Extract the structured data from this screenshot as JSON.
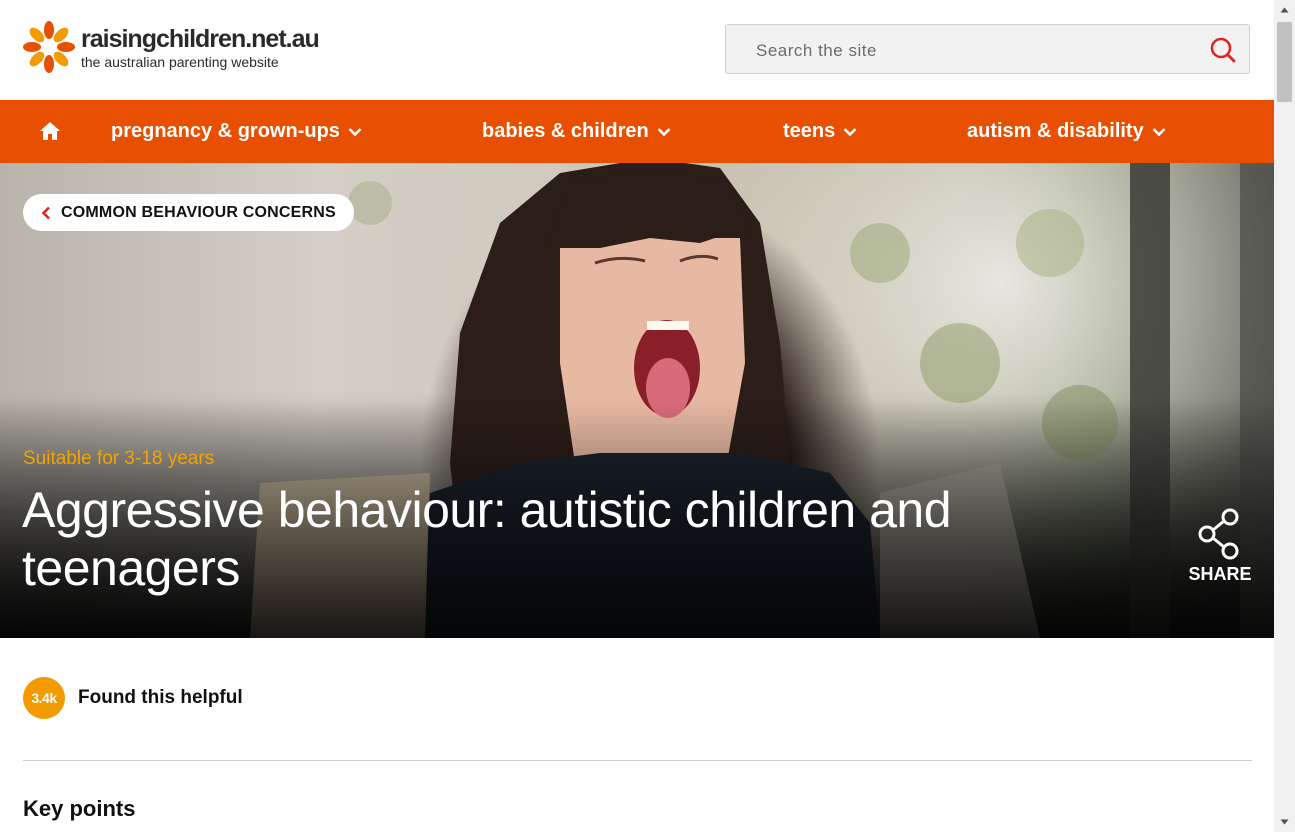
{
  "header": {
    "logo": {
      "name": "raisingchildren.net.au",
      "tagline": "the australian parenting website",
      "icon": "sunburst-logo-icon"
    },
    "search": {
      "placeholder": "Search the site",
      "value": "",
      "icon": "search-icon"
    }
  },
  "nav": {
    "home_icon": "home-icon",
    "items": [
      {
        "label": "pregnancy & grown-ups",
        "icon": "chevron-down-icon"
      },
      {
        "label": "babies & children",
        "icon": "chevron-down-icon"
      },
      {
        "label": "teens",
        "icon": "chevron-down-icon"
      },
      {
        "label": "autism & disability",
        "icon": "chevron-down-icon"
      }
    ]
  },
  "hero": {
    "back_link": "COMMON BEHAVIOUR CONCERNS",
    "suitable": "Suitable for 3-18 years",
    "title": "Aggressive behaviour: autistic children and teenagers",
    "share_label": "SHARE",
    "share_icon": "share-icon"
  },
  "article": {
    "helpful_count": "3.4k",
    "helpful_label": "Found this helpful",
    "section_heading": "Key points"
  },
  "colors": {
    "brand_orange": "#e84f00",
    "accent_amber": "#f29a00",
    "suitable_text": "#f5a300"
  }
}
